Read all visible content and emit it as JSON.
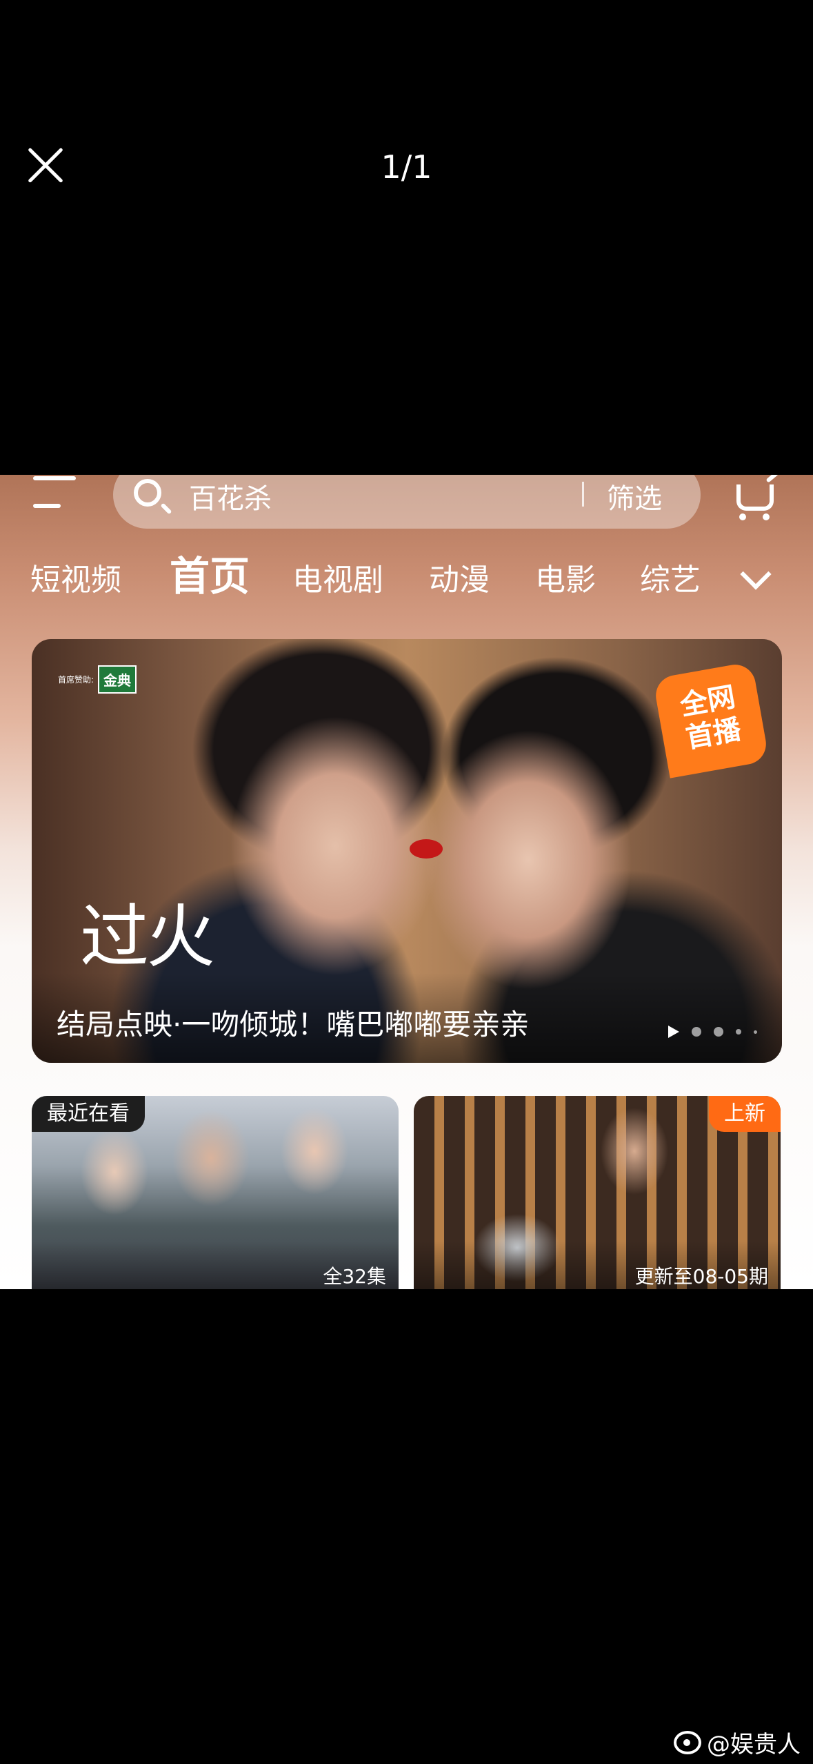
{
  "viewer": {
    "page_counter": "1/1"
  },
  "app": {
    "search": {
      "query": "百花杀",
      "filter_label": "筛选"
    },
    "tabs": [
      {
        "label": "短视频"
      },
      {
        "label": "首页",
        "active": true
      },
      {
        "label": "电视剧"
      },
      {
        "label": "动漫"
      },
      {
        "label": "电影"
      },
      {
        "label": "综艺"
      }
    ],
    "banner": {
      "caption": "结局点映·一吻倾城！嘴巴嘟嘟要亲亲",
      "show_logo_text": "过火",
      "sponsor_text": "首席赞助:",
      "sponsor_logo_text": "金典",
      "premiere_badge_line1": "全网",
      "premiere_badge_line2": "首播",
      "carousel_pages": 5,
      "carousel_current": 1
    },
    "cards": [
      {
        "tag": "最近在看",
        "info": "全32集"
      },
      {
        "tag": "上新",
        "info": "更新至08-05期"
      }
    ]
  },
  "watermark": "@娱贵人",
  "colors": {
    "accent_orange": "#ff6a14",
    "background": "#000000"
  }
}
